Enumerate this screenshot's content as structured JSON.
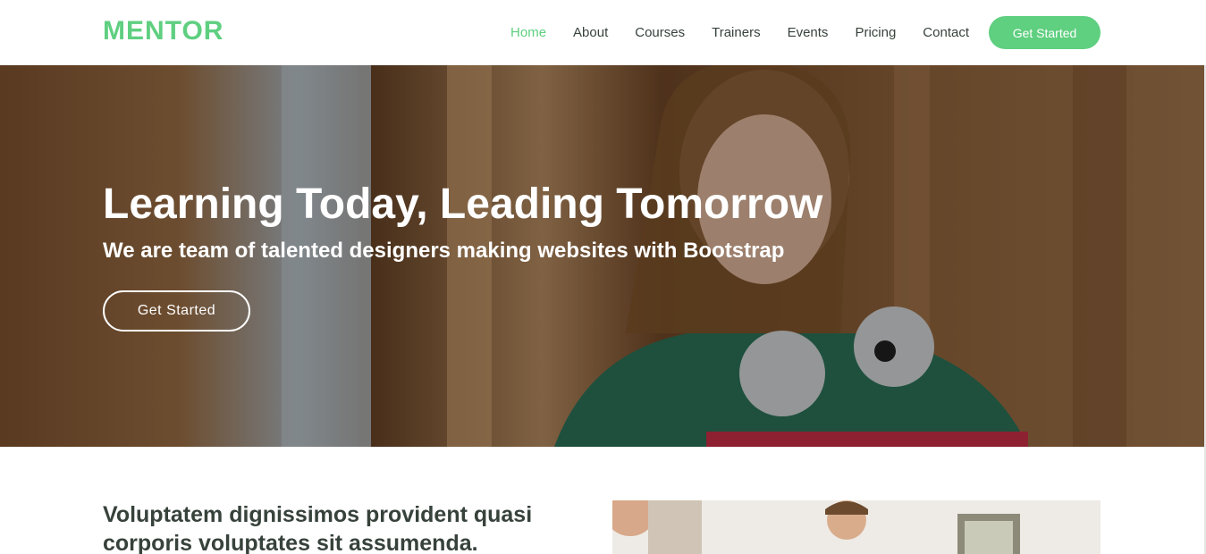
{
  "brand": {
    "logo": "MENTOR",
    "accent": "#5fcf80"
  },
  "nav": {
    "items": [
      {
        "label": "Home",
        "active": true
      },
      {
        "label": "About"
      },
      {
        "label": "Courses"
      },
      {
        "label": "Trainers"
      },
      {
        "label": "Events"
      },
      {
        "label": "Pricing"
      },
      {
        "label": "Contact"
      }
    ],
    "cta_label": "Get Started"
  },
  "hero": {
    "title": "Learning Today, Leading Tomorrow",
    "subtitle": "We are team of talented designers making websites with Bootstrap",
    "button_label": "Get Started"
  },
  "about": {
    "heading": "Voluptatem dignissimos provident quasi corporis voluptates sit assumenda."
  }
}
